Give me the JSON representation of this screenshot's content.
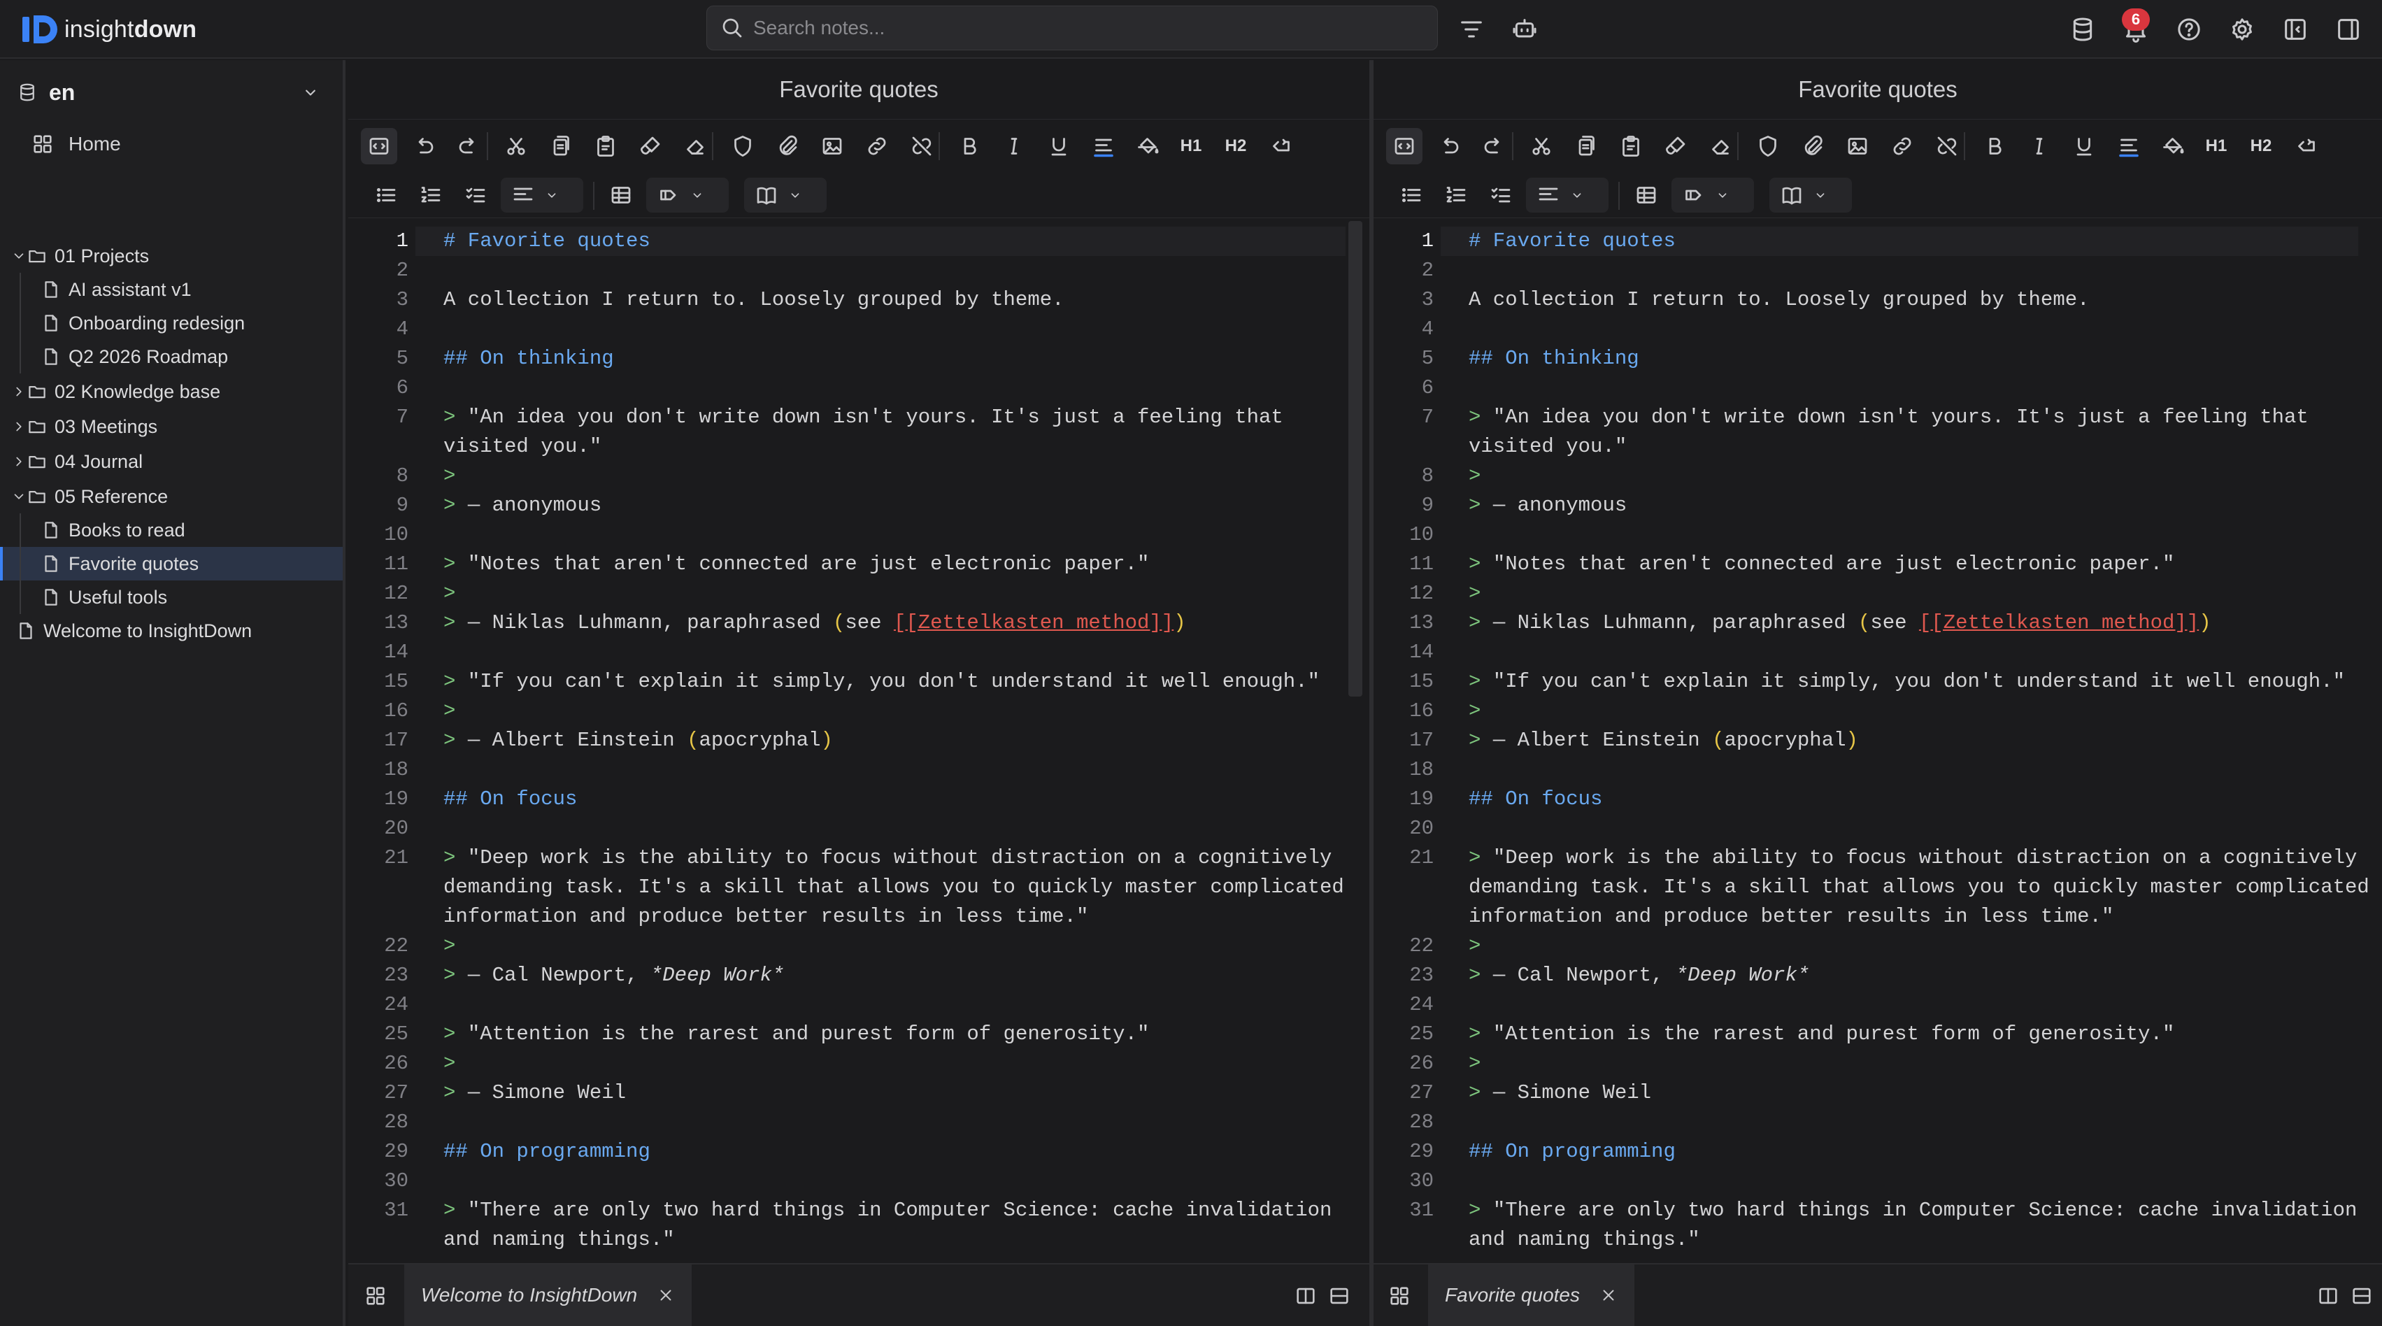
{
  "app": {
    "logo_mark": "iD",
    "logo_text_light": "insight",
    "logo_text_bold": "down",
    "search_placeholder": "Search notes...",
    "notification_count": "6",
    "accent": "#3b82f6",
    "badge_color": "#d9363e"
  },
  "sidebar": {
    "workspace": "en",
    "home_label": "Home",
    "tree": [
      {
        "label": "01 Projects",
        "type": "folder",
        "open": true
      },
      {
        "label": "AI assistant v1",
        "type": "file"
      },
      {
        "label": "Onboarding redesign",
        "type": "file"
      },
      {
        "label": "Q2 2026 Roadmap",
        "type": "file"
      },
      {
        "label": "02 Knowledge base",
        "type": "folder",
        "open": false
      },
      {
        "label": "03 Meetings",
        "type": "folder",
        "open": false
      },
      {
        "label": "04 Journal",
        "type": "folder",
        "open": false
      },
      {
        "label": "05 Reference",
        "type": "folder",
        "open": true
      },
      {
        "label": "Books to read",
        "type": "file"
      },
      {
        "label": "Favorite quotes",
        "type": "file",
        "selected": true
      },
      {
        "label": "Useful tools",
        "type": "file"
      },
      {
        "label": "Welcome to InsightDown",
        "type": "file"
      }
    ]
  },
  "panes": {
    "left_title": "Favorite quotes",
    "right_title": "Favorite quotes",
    "left_tab": "Welcome to InsightDown",
    "right_tab": "Favorite quotes",
    "heading_buttons": [
      "H1",
      "H2"
    ]
  },
  "document": {
    "lines": [
      {
        "n": "1",
        "segs": [
          [
            "h",
            "# Favorite quotes"
          ]
        ]
      },
      {
        "n": "2",
        "segs": []
      },
      {
        "n": "3",
        "segs": [
          [
            "t",
            "A collection I return to. Loosely grouped by theme."
          ]
        ]
      },
      {
        "n": "4",
        "segs": []
      },
      {
        "n": "5",
        "segs": [
          [
            "h",
            "## On thinking"
          ]
        ]
      },
      {
        "n": "6",
        "segs": []
      },
      {
        "n": "7",
        "segs": [
          [
            "q",
            "> "
          ],
          [
            "t",
            "\"An idea you don't write down isn't yours. It's just a feeling that"
          ]
        ]
      },
      {
        "n": "",
        "segs": [
          [
            "t",
            "visited you.\""
          ]
        ]
      },
      {
        "n": "8",
        "segs": [
          [
            "q",
            ">"
          ]
        ]
      },
      {
        "n": "9",
        "segs": [
          [
            "q",
            "> "
          ],
          [
            "t",
            "— anonymous"
          ]
        ]
      },
      {
        "n": "10",
        "segs": []
      },
      {
        "n": "11",
        "segs": [
          [
            "q",
            "> "
          ],
          [
            "t",
            "\"Notes that aren't connected are just electronic paper.\""
          ]
        ]
      },
      {
        "n": "12",
        "segs": [
          [
            "q",
            ">"
          ]
        ]
      },
      {
        "n": "13",
        "segs": [
          [
            "q",
            "> "
          ],
          [
            "t",
            "— Niklas Luhmann, paraphrased "
          ],
          [
            "p",
            "("
          ],
          [
            "t",
            "see "
          ],
          [
            "l",
            "[[Zettelkasten method]]"
          ],
          [
            "p",
            ")"
          ]
        ]
      },
      {
        "n": "14",
        "segs": []
      },
      {
        "n": "15",
        "segs": [
          [
            "q",
            "> "
          ],
          [
            "t",
            "\"If you can't explain it simply, you don't understand it well enough.\""
          ]
        ]
      },
      {
        "n": "16",
        "segs": [
          [
            "q",
            ">"
          ]
        ]
      },
      {
        "n": "17",
        "segs": [
          [
            "q",
            "> "
          ],
          [
            "t",
            "— Albert Einstein "
          ],
          [
            "p",
            "("
          ],
          [
            "t",
            "apocryphal"
          ],
          [
            "p",
            ")"
          ]
        ]
      },
      {
        "n": "18",
        "segs": []
      },
      {
        "n": "19",
        "segs": [
          [
            "h",
            "## On focus"
          ]
        ]
      },
      {
        "n": "20",
        "segs": []
      },
      {
        "n": "21",
        "segs": [
          [
            "q",
            "> "
          ],
          [
            "t",
            "\"Deep work is the ability to focus without distraction on a cognitively"
          ]
        ]
      },
      {
        "n": "",
        "segs": [
          [
            "t",
            "demanding task. It's a skill that allows you to quickly master complicated"
          ]
        ]
      },
      {
        "n": "",
        "segs": [
          [
            "t",
            "information and produce better results in less time.\""
          ]
        ]
      },
      {
        "n": "22",
        "segs": [
          [
            "q",
            ">"
          ]
        ]
      },
      {
        "n": "23",
        "segs": [
          [
            "q",
            "> "
          ],
          [
            "t",
            "— Cal Newport, "
          ],
          [
            "i",
            "*Deep Work*"
          ]
        ]
      },
      {
        "n": "24",
        "segs": []
      },
      {
        "n": "25",
        "segs": [
          [
            "q",
            "> "
          ],
          [
            "t",
            "\"Attention is the rarest and purest form of generosity.\""
          ]
        ]
      },
      {
        "n": "26",
        "segs": [
          [
            "q",
            ">"
          ]
        ]
      },
      {
        "n": "27",
        "segs": [
          [
            "q",
            "> "
          ],
          [
            "t",
            "— Simone Weil"
          ]
        ]
      },
      {
        "n": "28",
        "segs": []
      },
      {
        "n": "29",
        "segs": [
          [
            "h",
            "## On programming"
          ]
        ]
      },
      {
        "n": "30",
        "segs": []
      },
      {
        "n": "31",
        "segs": [
          [
            "q",
            "> "
          ],
          [
            "t",
            "\"There are only two hard things in Computer Science: cache invalidation"
          ]
        ]
      },
      {
        "n": "",
        "segs": [
          [
            "t",
            "and naming things.\""
          ]
        ]
      }
    ]
  }
}
